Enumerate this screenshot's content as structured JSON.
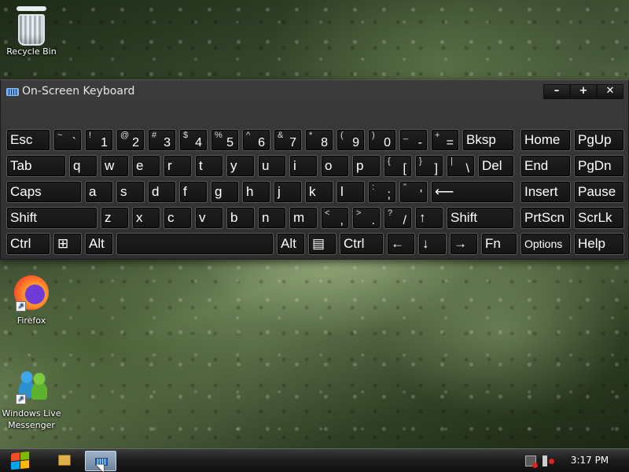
{
  "desktop": {
    "icons": [
      {
        "label": "Recycle Bin",
        "icon": "recycle-bin-icon"
      },
      {
        "label": "Firefox",
        "icon": "firefox-icon"
      },
      {
        "label": "Windows Live Messenger",
        "icon": "messenger-icon"
      }
    ]
  },
  "osk": {
    "title": "On-Screen Keyboard",
    "window_buttons": {
      "minimize": "–",
      "maximize": "+",
      "close": "✕"
    },
    "rows": [
      [
        {
          "main": "Esc"
        },
        {
          "sec": "~",
          "pri": "`"
        },
        {
          "sec": "!",
          "pri": "1"
        },
        {
          "sec": "@",
          "pri": "2"
        },
        {
          "sec": "#",
          "pri": "3"
        },
        {
          "sec": "$",
          "pri": "4"
        },
        {
          "sec": "%",
          "pri": "5"
        },
        {
          "sec": "^",
          "pri": "6"
        },
        {
          "sec": "&",
          "pri": "7"
        },
        {
          "sec": "*",
          "pri": "8"
        },
        {
          "sec": "(",
          "pri": "9"
        },
        {
          "sec": ")",
          "pri": "0"
        },
        {
          "sec": "_",
          "pri": "-"
        },
        {
          "sec": "+",
          "pri": "="
        },
        {
          "main": "Bksp"
        },
        {
          "main": "Home"
        },
        {
          "main": "PgUp"
        }
      ],
      [
        {
          "main": "Tab"
        },
        {
          "main": "q"
        },
        {
          "main": "w"
        },
        {
          "main": "e"
        },
        {
          "main": "r"
        },
        {
          "main": "t"
        },
        {
          "main": "y"
        },
        {
          "main": "u"
        },
        {
          "main": "i"
        },
        {
          "main": "o"
        },
        {
          "main": "p"
        },
        {
          "sec": "{",
          "pri": "["
        },
        {
          "sec": "}",
          "pri": "]"
        },
        {
          "sec": "|",
          "pri": "\\"
        },
        {
          "main": "Del"
        },
        {
          "main": "End"
        },
        {
          "main": "PgDn"
        }
      ],
      [
        {
          "main": "Caps"
        },
        {
          "main": "a"
        },
        {
          "main": "s"
        },
        {
          "main": "d"
        },
        {
          "main": "f"
        },
        {
          "main": "g"
        },
        {
          "main": "h"
        },
        {
          "main": "j"
        },
        {
          "main": "k"
        },
        {
          "main": "l"
        },
        {
          "sec": ":",
          "pri": ";"
        },
        {
          "sec": "\"",
          "pri": "'"
        },
        {
          "main": "⟵"
        },
        {
          "main": "Insert"
        },
        {
          "main": "Pause"
        }
      ],
      [
        {
          "main": "Shift"
        },
        {
          "main": "z"
        },
        {
          "main": "x"
        },
        {
          "main": "c"
        },
        {
          "main": "v"
        },
        {
          "main": "b"
        },
        {
          "main": "n"
        },
        {
          "main": "m"
        },
        {
          "sec": "<",
          "pri": ","
        },
        {
          "sec": ">",
          "pri": "."
        },
        {
          "sec": "?",
          "pri": "/"
        },
        {
          "main": "↑"
        },
        {
          "main": "Shift"
        },
        {
          "main": "PrtScn"
        },
        {
          "main": "ScrLk"
        }
      ],
      [
        {
          "main": "Ctrl"
        },
        {
          "main": "⊞"
        },
        {
          "main": "Alt"
        },
        {
          "main": ""
        },
        {
          "main": "Alt"
        },
        {
          "main": "▤"
        },
        {
          "main": "Ctrl"
        },
        {
          "main": "←"
        },
        {
          "main": "↓"
        },
        {
          "main": "→"
        },
        {
          "main": "Fn"
        },
        {
          "main": "Options"
        },
        {
          "main": "Help"
        }
      ]
    ]
  },
  "taskbar": {
    "clock": "3:17 PM"
  },
  "colors": {
    "window_bg": "#333333",
    "key_bg": "#1a1a1a",
    "key_border": "#5a5a5a",
    "taskbar_active": "#8fa6bd"
  }
}
